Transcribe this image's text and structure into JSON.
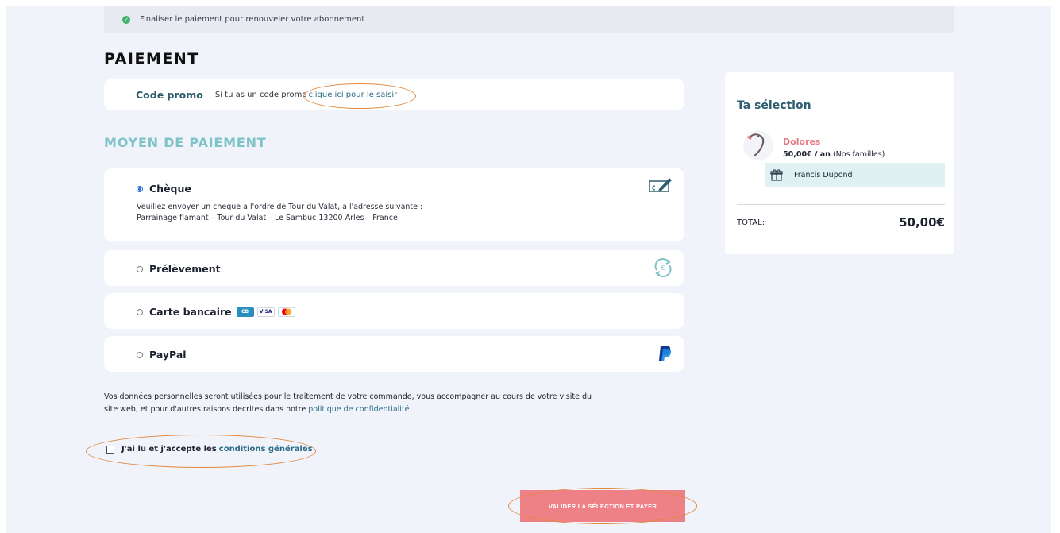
{
  "notice": {
    "text": "Finaliser le paiement pour renouveler votre abonnement"
  },
  "page": {
    "title": "PAIEMENT"
  },
  "promo": {
    "label": "Code promo",
    "text": "Si tu as un code promo",
    "link": "clique ici pour le saisir"
  },
  "payment": {
    "section_title": "MOYEN DE PAIEMENT",
    "options": [
      {
        "label": "Chèque",
        "selected": true,
        "icon": "cheque-icon",
        "desc_line1": "Veuillez envoyer un cheque a l'ordre de Tour du Valat, a l'adresse suivante :",
        "desc_line2": "Parrainage flamant – Tour du Valat – Le Sambuc 13200 Arles – France"
      },
      {
        "label": "Prélèvement",
        "selected": false,
        "icon": "recurring-payment-icon"
      },
      {
        "label": "Carte bancaire",
        "selected": false,
        "badges": [
          "CB",
          "VISA",
          "MC"
        ]
      },
      {
        "label": "PayPal",
        "selected": false,
        "icon": "paypal-icon"
      }
    ]
  },
  "privacy": {
    "text": "Vos données personnelles seront utilisées pour le traitement de votre commande, vous accompagner au cours de votre visite du site web, et pour d'autres raisons decrites dans notre",
    "link": "politique de confidentialité"
  },
  "terms": {
    "text": "J'ai lu et j'accepte les",
    "link": "conditions générales",
    "checked": false
  },
  "submit": {
    "label": "VALIDER LA SÉLECTION ET PAYER"
  },
  "summary": {
    "title": "Ta sélection",
    "item_name": "Dolores",
    "item_price": "50,00€ / an",
    "item_plan": "(Nos familles)",
    "gift_name": "Francis Dupond",
    "total_label": "TOTAL:",
    "total_value": "50,00€"
  },
  "colors": {
    "accent_teal": "#7ec3c8",
    "heading_dark_teal": "#2d5d6f",
    "button_pink": "#ee8186",
    "annotation_orange": "#e0873e",
    "background": "#f1f3fa"
  }
}
